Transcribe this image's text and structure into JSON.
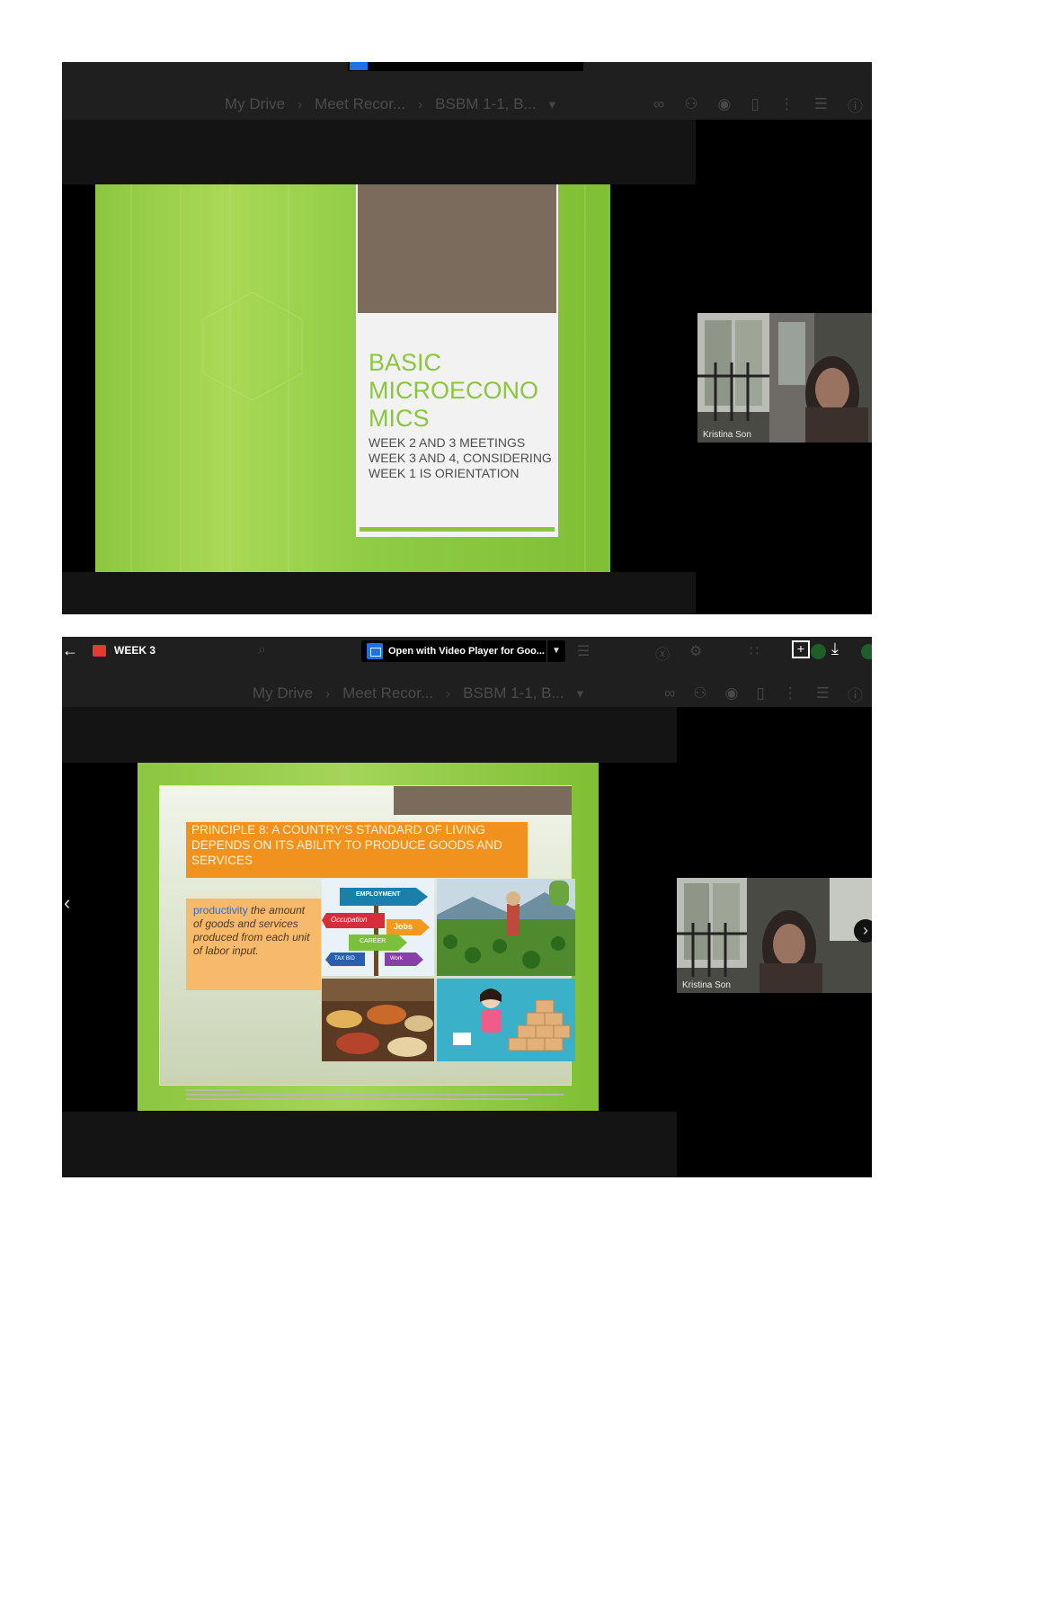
{
  "screenshot1": {
    "breadcrumb": [
      "My Drive",
      "Meet Recor...",
      "BSBM 1-1, B..."
    ],
    "slide": {
      "title": "BASIC MICROECONO MICS",
      "subtitle": "WEEK 2 AND 3 MEETINGS WEEK 3 AND 4, CONSIDERING WEEK 1 IS ORIENTATION"
    },
    "participant": {
      "name": "Kristina Son"
    }
  },
  "screenshot2": {
    "file_name": "WEEK 3",
    "open_with_label": "Open with Video Player for Goo...",
    "breadcrumb": [
      "My Drive",
      "Meet Recor...",
      "BSBM 1-1, B..."
    ],
    "slide": {
      "title": "PRINCIPLE 8: A COUNTRY'S STANDARD OF LIVING DEPENDS ON ITS ABILITY TO PRODUCE GOODS AND SERVICES",
      "definition_term": "productivity",
      "definition_text": "the amount of goods and services produced from each unit of labor input.",
      "sign_labels": [
        "EMPLOYMENT",
        "Occupation",
        "Jobs",
        "CAREER",
        "TAX BID",
        "Work"
      ]
    },
    "participant": {
      "name": "Kristina Son"
    }
  },
  "icon_names": [
    "back-arrow-icon",
    "file-icon",
    "search-icon",
    "link-icon",
    "add-person-icon",
    "preview-icon",
    "trash-icon",
    "more-icon",
    "list-view-icon",
    "info-icon",
    "add-to-drive-icon",
    "download-icon",
    "chevron-left-icon",
    "chevron-right-icon"
  ],
  "colors": {
    "slide_green": "#8cc63f",
    "slide_brown": "#7a6b5d",
    "banner_orange": "#f2921e",
    "drive_dark": "#1f1f1f"
  }
}
